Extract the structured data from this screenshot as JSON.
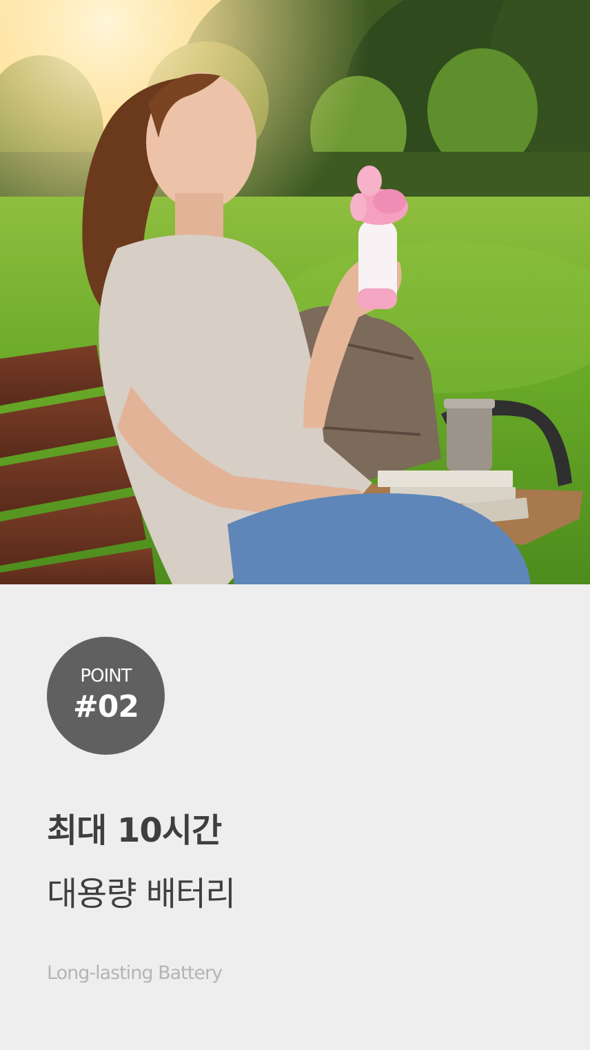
{
  "hero": {
    "icon": "photo-woman-with-handheld-fan-on-park-bench",
    "colors": {
      "grass": "#6fae2a",
      "sky": "#f7d98b",
      "fan": "#f6a0bf",
      "shirt": "#d7cec5",
      "jeans": "#5f86b8",
      "bench": "#6a3423"
    }
  },
  "point": {
    "label": "POINT",
    "number": "#02"
  },
  "headline": "최대 10시간",
  "subheadline": "대용량 배터리",
  "caption": "Long-lasting Battery",
  "colors": {
    "background": "#eeeeee",
    "badge": "#606060",
    "headline": "#3f3f3f",
    "caption": "#b4b4b4"
  }
}
